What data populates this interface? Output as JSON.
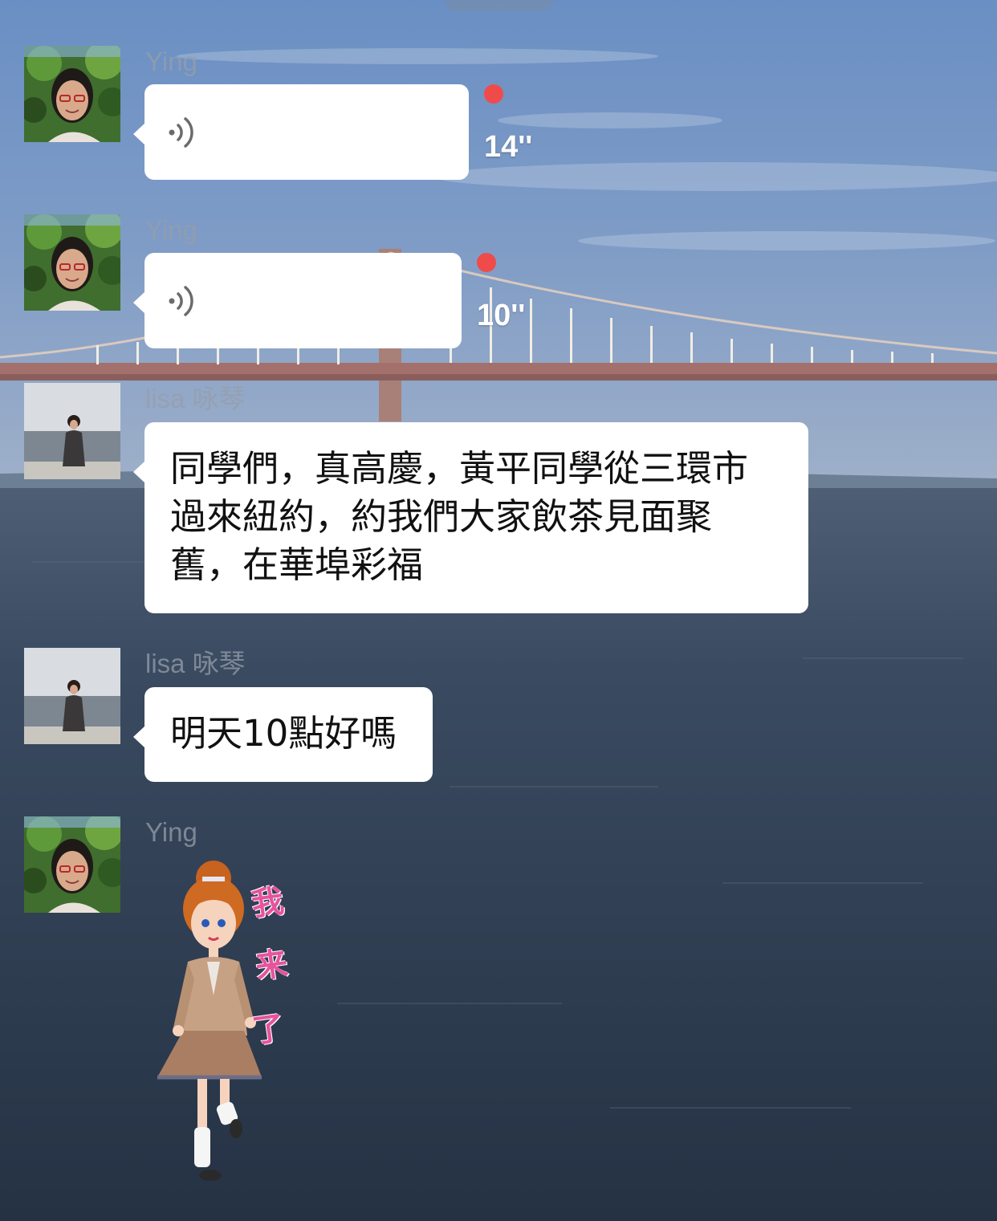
{
  "colors": {
    "bubble": "#ffffff",
    "unread_dot": "#f04b4b",
    "sender_name": "#969eaa",
    "sticker_caption": "#e7539d"
  },
  "messages": [
    {
      "sender": "Ying",
      "type": "voice",
      "duration": "14''",
      "unread": true,
      "avatar": "ying-avatar"
    },
    {
      "sender": "Ying",
      "type": "voice",
      "duration": "10''",
      "unread": true,
      "avatar": "ying-avatar"
    },
    {
      "sender": "lisa 咏琴",
      "type": "text",
      "lines": [
        "同學們，真高慶，黃平同學從三環市",
        "過來紐約，約我們大家飲茶見面聚",
        "舊，在華埠彩福"
      ],
      "avatar": "lisa-avatar"
    },
    {
      "sender": "lisa 咏琴",
      "type": "text",
      "lines": [
        "明天10點好嗎"
      ],
      "avatar": "lisa-avatar"
    },
    {
      "sender": "Ying",
      "type": "sticker",
      "sticker_text": [
        "我",
        "来",
        "了"
      ],
      "avatar": "ying-avatar"
    }
  ]
}
